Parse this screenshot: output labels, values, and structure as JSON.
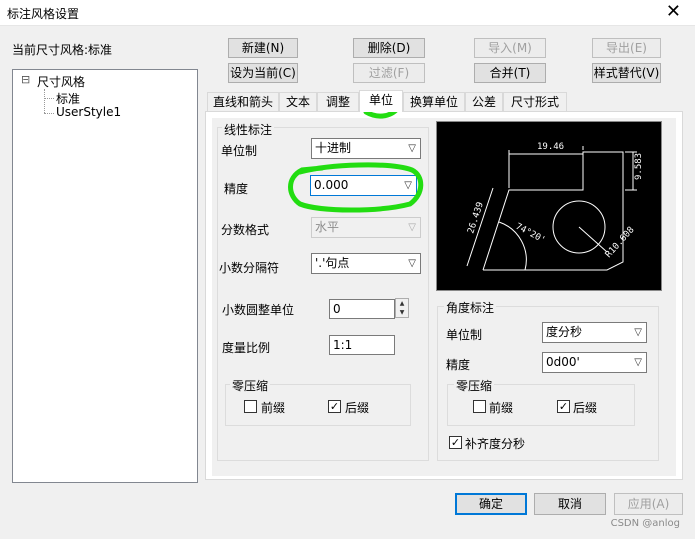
{
  "window": {
    "title": "标注风格设置",
    "close_glyph": "✕"
  },
  "current_style_label": "当前尺寸风格:标准",
  "buttons": {
    "new": "新建(N)",
    "delete": "删除(D)",
    "import": "导入(M)",
    "export": "导出(E)",
    "set_current": "设为当前(C)",
    "filter": "过滤(F)",
    "merge": "合并(T)",
    "override": "样式替代(V)",
    "ok": "确定",
    "cancel": "取消",
    "apply": "应用(A)"
  },
  "tree": {
    "root_toggle": "⊟",
    "root": "尺寸风格",
    "children": [
      "标准",
      "UserStyle1"
    ]
  },
  "tabs": [
    "直线和箭头",
    "文本",
    "调整",
    "单位",
    "换算单位",
    "公差",
    "尺寸形式"
  ],
  "active_tab": "单位",
  "linear": {
    "group_title": "线性标注",
    "unit_format_label": "单位制",
    "unit_format_value": "十进制",
    "precision_label": "精度",
    "precision_value": "0.000",
    "fraction_label": "分数格式",
    "fraction_value": "水平",
    "decimal_sep_label": "小数分隔符",
    "decimal_sep_value": "'.'句点",
    "round_label": "小数圆整单位",
    "round_value": "0",
    "scale_label": "度量比例",
    "scale_value": "1:1",
    "zero_group": "零压缩",
    "leading_label": "前缀",
    "leading_checked": false,
    "trailing_label": "后缀",
    "trailing_checked": true
  },
  "angular": {
    "group_title": "角度标注",
    "unit_format_label": "单位制",
    "unit_format_value": "度分秒",
    "precision_label": "精度",
    "precision_value": "0d00'",
    "zero_group": "零压缩",
    "leading_label": "前缀",
    "leading_checked": false,
    "trailing_label": "后缀",
    "trailing_checked": true,
    "pad_label": "补齐度分秒",
    "pad_checked": true
  },
  "preview": {
    "dim_top": "19.46",
    "dim_right": "9.583",
    "dim_left": "26.439",
    "dim_angle": "74°20'",
    "dim_radius": "R10.608"
  },
  "highlight_color": "#22dd11",
  "watermark": "CSDN @anlog"
}
